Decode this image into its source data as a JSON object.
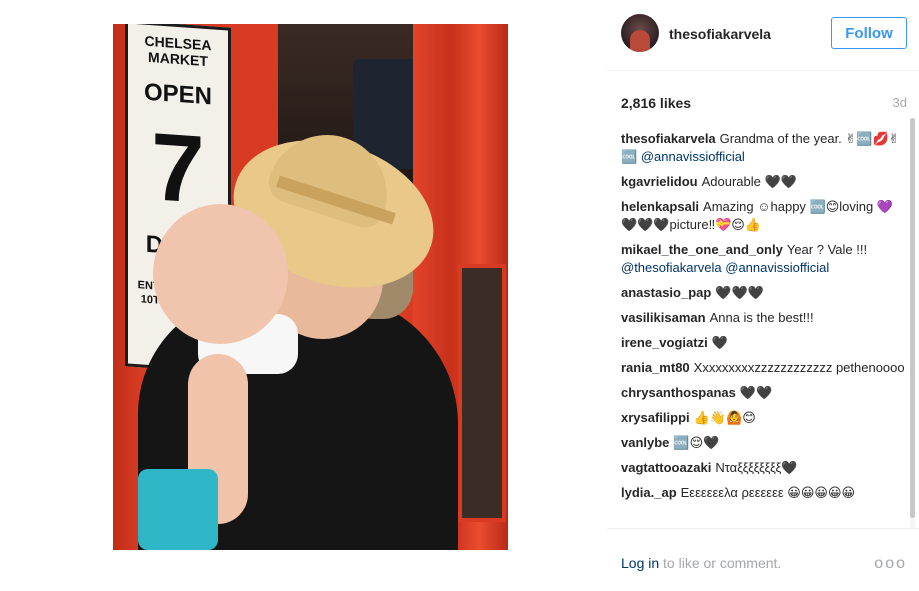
{
  "post": {
    "username": "thesofiakarvela",
    "follow_label": "Follow",
    "likes": "2,816 likes",
    "age": "3d"
  },
  "photo": {
    "sign_top": "CHELSEA MARKET",
    "sign_open": "OPEN",
    "sign_number": "7",
    "sign_days": "DAYS",
    "sign_entrance": "ENTRANCE ON 10TH AVENUE"
  },
  "comments": [
    {
      "user": "thesofiakarvela",
      "text": "Grandma of the year. ✌🆒💋✌🆒",
      "mention": "@annavissiofficial"
    },
    {
      "user": "kgavrielidou",
      "text": "Adourable 🖤🖤",
      "mention": ""
    },
    {
      "user": "helenkapsali",
      "text": "Amazing ☺happy 🆒😊loving 💜🖤🖤🖤picture‼💝😌👍",
      "mention": ""
    },
    {
      "user": "mikael_the_one_and_only",
      "text": "Year ? Vale !!!",
      "mention": "@thesofiakarvela @annavissiofficial"
    },
    {
      "user": "anastasio_pap",
      "text": "🖤🖤🖤",
      "mention": ""
    },
    {
      "user": "vasilikisaman",
      "text": "Anna is the best!!!",
      "mention": ""
    },
    {
      "user": "irene_vogiatzi",
      "text": "🖤",
      "mention": ""
    },
    {
      "user": "rania_mt80",
      "text": "Xxxxxxxxxzzzzzzzzzzzz pethenoooo",
      "mention": ""
    },
    {
      "user": "chrysanthospanas",
      "text": "🖤🖤",
      "mention": ""
    },
    {
      "user": "xrysafilippi",
      "text": "👍👋🙆😊",
      "mention": ""
    },
    {
      "user": "vanlybe",
      "text": "🆒😌🖤",
      "mention": ""
    },
    {
      "user": "vagtattooazaki",
      "text": "Νταξξξξξξξξ🖤",
      "mention": ""
    },
    {
      "user": "lydia._ap",
      "text": "Εεεεεεελα ρεεεεεε 😀😀😀😀😀",
      "mention": ""
    }
  ],
  "footer": {
    "login_link": "Log in",
    "login_rest": "to like or comment.",
    "more": "ooo"
  },
  "icons": {
    "avatar": "profile-avatar",
    "more": "more-options-icon"
  },
  "colors": {
    "link_blue": "#3897f0",
    "mention_blue": "#003569",
    "muted": "#a5a7aa"
  }
}
